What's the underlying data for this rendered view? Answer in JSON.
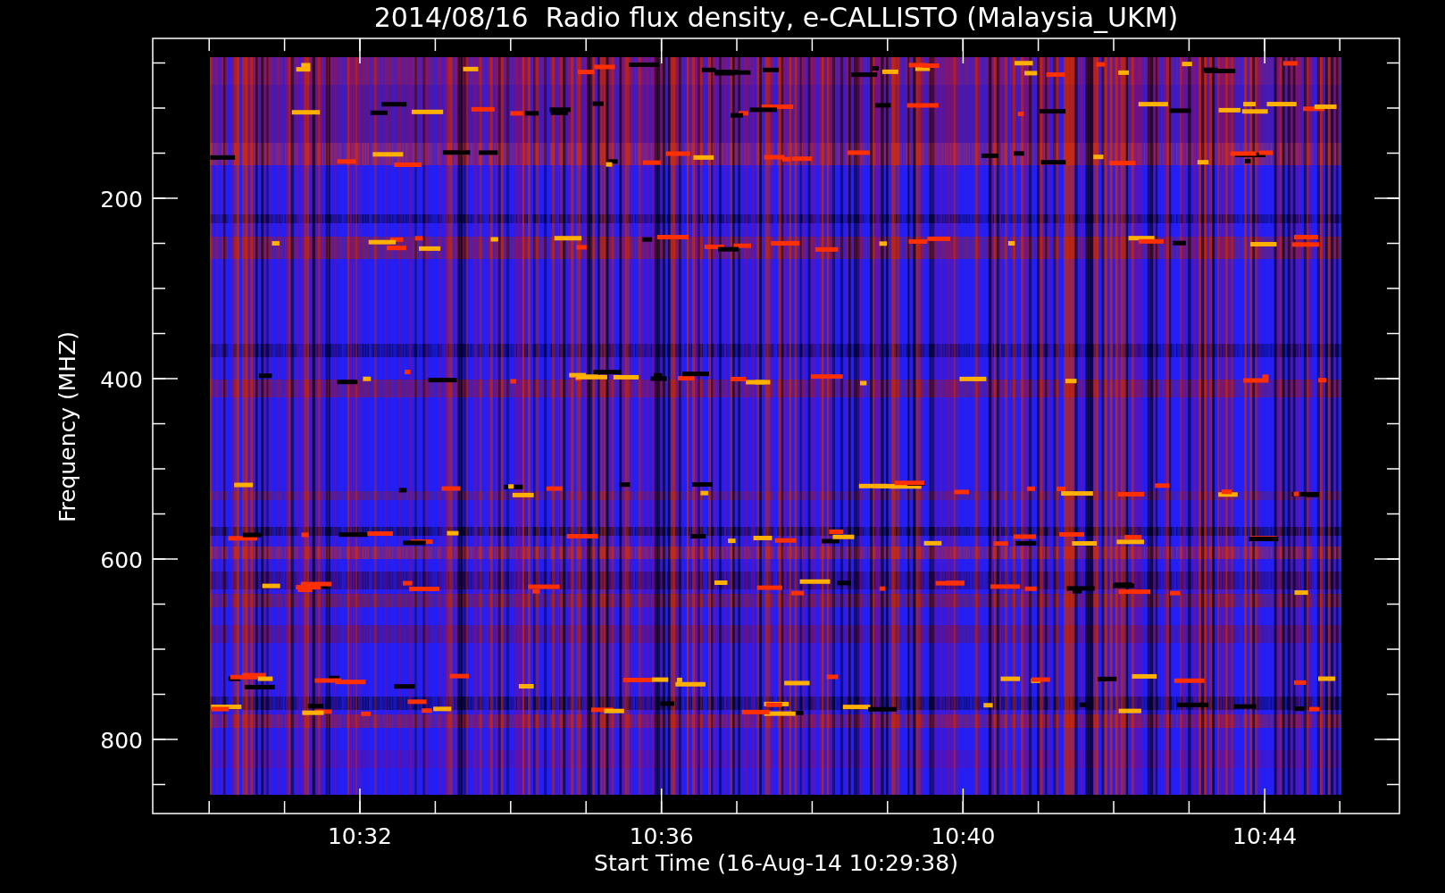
{
  "title": "2014/08/16  Radio flux density, e-CALLISTO (Malaysia_UKM)",
  "ylabel": "Frequency (MHZ)",
  "xlabel": "Start Time (16-Aug-14 10:29:38)",
  "yticks": [
    "200",
    "400",
    "600",
    "800"
  ],
  "xticks": [
    "10:32",
    "10:36",
    "10:40",
    "10:44"
  ]
}
